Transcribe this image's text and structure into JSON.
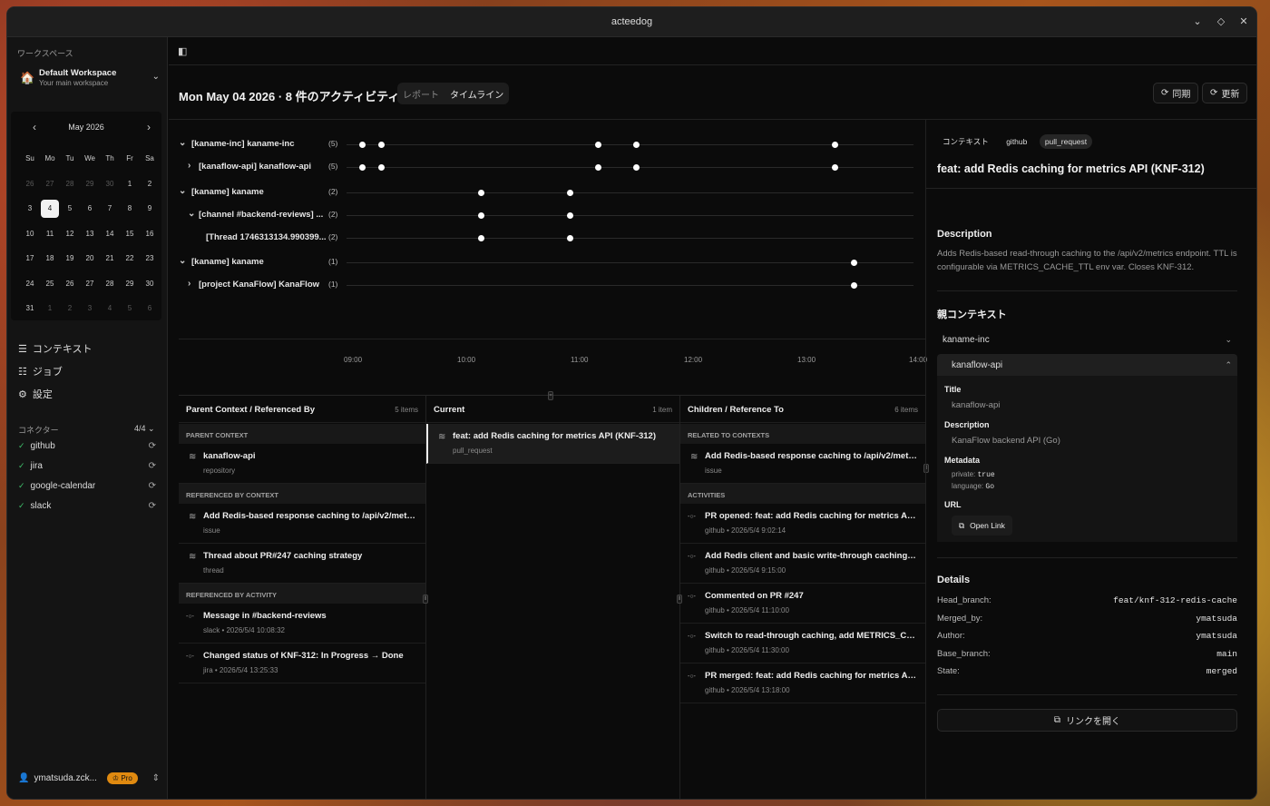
{
  "app": {
    "title": "acteedog"
  },
  "sidebar": {
    "workspace_label": "ワークスペース",
    "workspace_name": "Default Workspace",
    "workspace_sub": "Your main workspace",
    "calendar": {
      "month": "May 2026",
      "weekdays": [
        "Su",
        "Mo",
        "Tu",
        "We",
        "Th",
        "Fr",
        "Sa"
      ],
      "days": [
        "26",
        "27",
        "28",
        "29",
        "30",
        "1",
        "2",
        "3",
        "4",
        "5",
        "6",
        "7",
        "8",
        "9",
        "10",
        "11",
        "12",
        "13",
        "14",
        "15",
        "16",
        "17",
        "18",
        "19",
        "20",
        "21",
        "22",
        "23",
        "24",
        "25",
        "26",
        "27",
        "28",
        "29",
        "30",
        "31",
        "1",
        "2",
        "3",
        "4",
        "5",
        "6"
      ],
      "selected": "4"
    },
    "nav": [
      {
        "label": "コンテキスト"
      },
      {
        "label": "ジョブ"
      },
      {
        "label": "設定"
      }
    ],
    "connectors_label": "コネクター",
    "connectors_count": "4/4",
    "connectors": [
      {
        "name": "github"
      },
      {
        "name": "jira"
      },
      {
        "name": "google-calendar"
      },
      {
        "name": "slack"
      }
    ],
    "user": {
      "name": "ymatsuda.zck...",
      "badge": "Pro"
    }
  },
  "header": {
    "title": "Mon May 04 2026 · 8 件のアクティビティ",
    "tabs": [
      {
        "label": "レポート"
      },
      {
        "label": "タイムライン"
      }
    ],
    "sync_label": "同期",
    "refresh_label": "更新"
  },
  "timeline": {
    "rows": [
      {
        "label": "[kaname-inc] kaname-inc",
        "count": "(5)",
        "chev": "⌄",
        "times": [
          "09:05",
          "09:15",
          "11:10",
          "11:30",
          "13:15"
        ]
      },
      {
        "label": "[kanaflow-api] kanaflow-api",
        "count": "(5)",
        "chev": "›",
        "times": [
          "09:05",
          "09:15",
          "11:10",
          "11:30",
          "13:15"
        ]
      },
      {
        "label": "[kaname] kaname",
        "count": "(2)",
        "chev": "⌄",
        "times": [
          "10:08",
          "10:55"
        ]
      },
      {
        "label": "[channel #backend-reviews] ...",
        "count": "(2)",
        "chev": "⌄",
        "times": [
          "10:08",
          "10:55"
        ]
      },
      {
        "label": "[Thread 1746313134.990399...",
        "count": "(2)",
        "chev": "",
        "times": [
          "10:08",
          "10:55"
        ]
      },
      {
        "label": "[kaname] kaname",
        "count": "(1)",
        "chev": "⌄",
        "times": [
          "13:25"
        ]
      },
      {
        "label": "[project KanaFlow] KanaFlow",
        "count": "(1)",
        "chev": "›",
        "times": [
          "13:25"
        ]
      }
    ],
    "ticks": [
      "09:00",
      "10:00",
      "11:00",
      "12:00",
      "13:00",
      "14:00"
    ]
  },
  "parent_col": {
    "title": "Parent Context / Referenced By",
    "count": "5 items",
    "groups": [
      {
        "label": "PARENT CONTEXT",
        "items": [
          {
            "title": "kanaflow-api",
            "sub": "repository"
          }
        ]
      },
      {
        "label": "REFERENCED BY CONTEXT",
        "items": [
          {
            "title": "Add Redis-based response caching to /api/v2/metri...",
            "sub": "issue"
          },
          {
            "title": "Thread about PR#247 caching strategy",
            "sub": "thread"
          }
        ]
      },
      {
        "label": "REFERENCED BY ACTIVITY",
        "items": [
          {
            "title": "Message in #backend-reviews",
            "sub": "slack • 2026/5/4 10:08:32"
          },
          {
            "title": "Changed status of KNF-312: In Progress → Done",
            "sub": "jira • 2026/5/4 13:25:33"
          }
        ]
      }
    ]
  },
  "current_col": {
    "title": "Current",
    "count": "1 item",
    "item": {
      "title": "feat: add Redis caching for metrics API (KNF-312)",
      "sub": "pull_request"
    }
  },
  "children_col": {
    "title": "Children / Reference To",
    "count": "6 items",
    "groups": [
      {
        "label": "RELATED TO CONTEXTS",
        "items": [
          {
            "title": "Add Redis-based response caching to /api/v2/metri...",
            "sub": "issue"
          }
        ]
      },
      {
        "label": "ACTIVITIES",
        "items": [
          {
            "title": "PR opened: feat: add Redis caching for metrics API (...",
            "sub": "github • 2026/5/4 9:02:14"
          },
          {
            "title": "Add Redis client and basic write-through caching la...",
            "sub": "github • 2026/5/4 9:15:00"
          },
          {
            "title": "Commented on PR #247",
            "sub": "github • 2026/5/4 11:10:00"
          },
          {
            "title": "Switch to read-through caching, add METRICS_CACH...",
            "sub": "github • 2026/5/4 11:30:00"
          },
          {
            "title": "PR merged: feat: add Redis caching for metrics API (...",
            "sub": "github • 2026/5/4 13:18:00"
          }
        ]
      }
    ]
  },
  "detail": {
    "chips": [
      "コンテキスト",
      "github",
      "pull_request"
    ],
    "title": "feat: add Redis caching for metrics API (KNF-312)",
    "description_label": "Description",
    "description": "Adds Redis-based read-through caching to the /api/v2/metrics endpoint. TTL is configurable via METRICS_CACHE_TTL env var. Closes KNF-312.",
    "parent_label": "親コンテキスト",
    "parent_closed": "kaname-inc",
    "parent_open": "kanaflow-api",
    "parent_box": {
      "title_k": "Title",
      "title_v": "kanaflow-api",
      "desc_k": "Description",
      "desc_v": "KanaFlow backend API (Go)",
      "meta_k": "Metadata",
      "meta": [
        {
          "k": "private:",
          "v": "true"
        },
        {
          "k": "language:",
          "v": "Go"
        }
      ],
      "url_k": "URL",
      "open_link": "Open Link"
    },
    "details_label": "Details",
    "details": [
      {
        "k": "Head_branch:",
        "v": "feat/knf-312-redis-cache"
      },
      {
        "k": "Merged_by:",
        "v": "ymatsuda"
      },
      {
        "k": "Author:",
        "v": "ymatsuda"
      },
      {
        "k": "Base_branch:",
        "v": "main"
      },
      {
        "k": "State:",
        "v": "merged"
      }
    ],
    "open_link_button": "リンクを開く"
  }
}
